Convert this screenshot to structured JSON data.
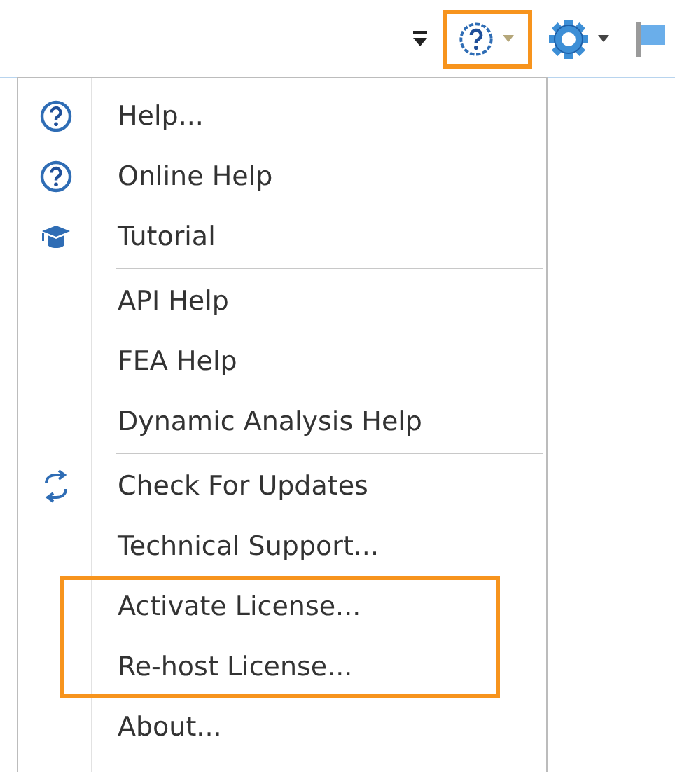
{
  "toolbar": {
    "buttons": [
      {
        "kind": "overflow",
        "highlighted": false
      },
      {
        "kind": "help",
        "highlighted": true
      },
      {
        "kind": "settings",
        "highlighted": false
      },
      {
        "kind": "flag",
        "highlighted": false
      }
    ]
  },
  "menu": {
    "items": [
      {
        "kind": "help",
        "label": "Help...",
        "highlighted": false
      },
      {
        "kind": "help",
        "label": "Online Help",
        "highlighted": false
      },
      {
        "kind": "tutorial",
        "label": "Tutorial",
        "highlighted": false
      },
      {
        "kind": "separator"
      },
      {
        "kind": "item",
        "label": "API Help",
        "highlighted": false
      },
      {
        "kind": "item",
        "label": "FEA Help",
        "highlighted": false
      },
      {
        "kind": "item",
        "label": "Dynamic Analysis Help",
        "highlighted": false
      },
      {
        "kind": "separator"
      },
      {
        "kind": "update",
        "label": "Check For Updates",
        "highlighted": false
      },
      {
        "kind": "item",
        "label": "Technical Support...",
        "highlighted": false
      },
      {
        "kind": "item",
        "label": "Activate License...",
        "highlighted": true
      },
      {
        "kind": "item",
        "label": "Re-host License...",
        "highlighted": true
      },
      {
        "kind": "item",
        "label": "About...",
        "highlighted": false
      }
    ]
  }
}
